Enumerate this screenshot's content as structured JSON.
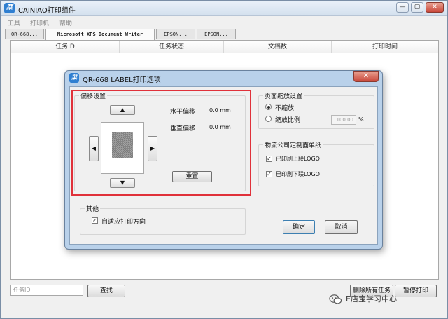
{
  "window": {
    "title": "CAINIAO打印组件",
    "icon_glyph": "菜",
    "minimize": "—",
    "maximize": "▢",
    "close": "✕"
  },
  "menu": [
    "工具",
    "打印机",
    "帮助"
  ],
  "tabs": [
    "QR-668...",
    "Microsoft XPS Document Writer",
    "EPSON...",
    "EPSON..."
  ],
  "table": {
    "columns": [
      "任务ID",
      "任务状态",
      "文档数",
      "打印时间"
    ],
    "rows": []
  },
  "bottom": {
    "task_id_placeholder": "任务ID",
    "find_button": "查找",
    "delete_all_button": "删除所有任务",
    "pause_button": "暂停打印"
  },
  "watermark": {
    "text": "E店宝学习中心"
  },
  "dialog": {
    "title": "QR-668 LABEL打印选项",
    "close": "✕",
    "offset_group": {
      "label": "偏移设置",
      "up": "▲",
      "down": "▼",
      "left": "◀",
      "right": "▶",
      "horizontal_label": "水平偏移",
      "horizontal_value": "0.0 mm",
      "vertical_label": "垂直偏移",
      "vertical_value": "0.0 mm",
      "reset_button": "重置"
    },
    "other_group": {
      "label": "其他",
      "auto_orientation": {
        "label": "自适应打印方向",
        "checked": true
      }
    },
    "scale_group": {
      "label": "页面缩放设置",
      "no_scale": {
        "label": "不缩放",
        "selected": true
      },
      "scale_ratio": {
        "label": "缩放比例",
        "selected": false,
        "value": "100.00",
        "unit": "%"
      }
    },
    "logistics_group": {
      "label": "物流公司定制面单纸",
      "print_upper_logo": {
        "label": "已印刷上联LOGO",
        "checked": true
      },
      "print_lower_logo": {
        "label": "已印刷下联LOGO",
        "checked": true
      }
    },
    "ok_button": "确定",
    "cancel_button": "取消"
  },
  "colors": {
    "highlight": "#e0313a",
    "dialog_frame": "#b9d1ea",
    "app_icon": "#2f7fd1"
  }
}
